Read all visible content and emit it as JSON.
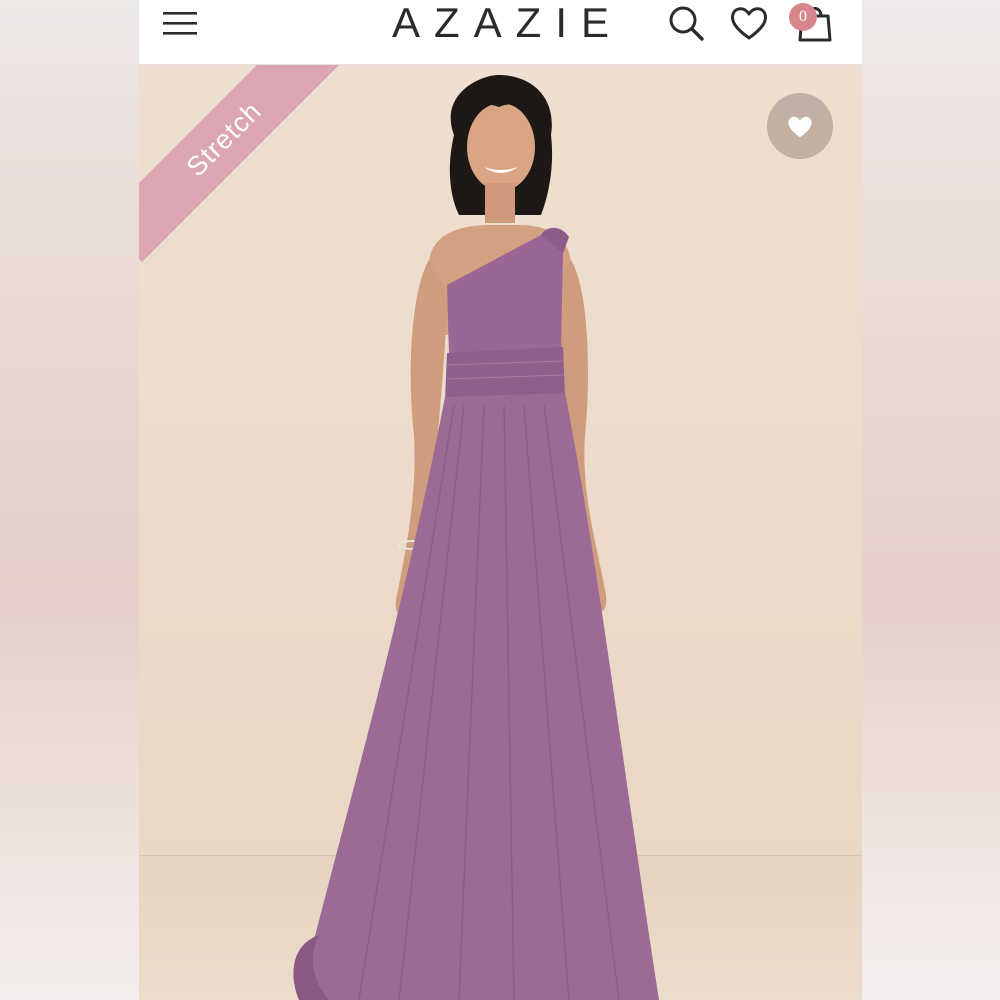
{
  "header": {
    "logo": "AZAZIE",
    "cart_count": "0",
    "icons": [
      "menu-icon",
      "search-icon",
      "heart-icon",
      "shopping-bag-icon"
    ]
  },
  "product": {
    "badge": "Stretch",
    "favorite_icon": "heart-filled-icon",
    "dress_color": "#9b6a95",
    "badge_color": "#dba6b2"
  }
}
